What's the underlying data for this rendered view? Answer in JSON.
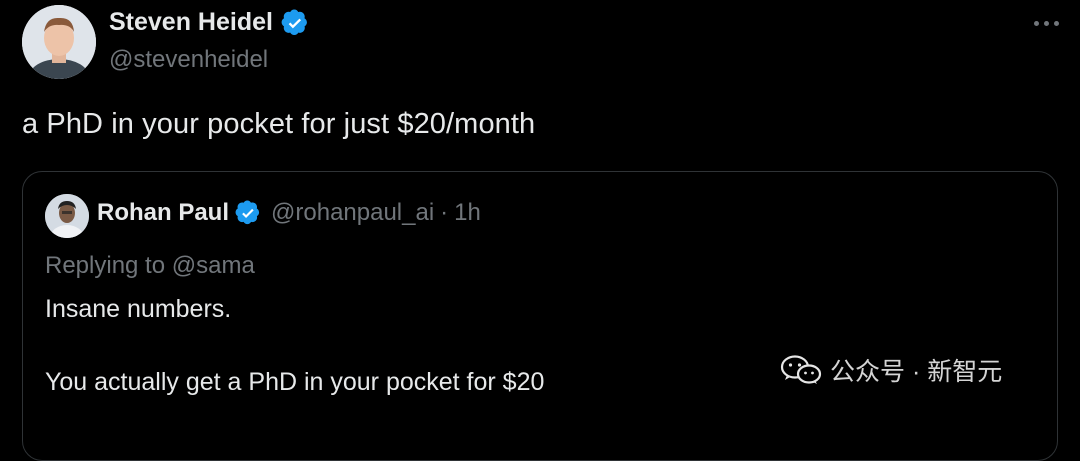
{
  "tweet": {
    "author_name": "Steven Heidel",
    "author_handle": "@stevenheidel",
    "text": "a PhD in your pocket for just $20/month",
    "more_icon": "more-horizontal-icon",
    "verified_color": "#1d9bf0"
  },
  "quoted": {
    "author_name": "Rohan Paul",
    "author_handle": "@rohanpaul_ai",
    "separator": "·",
    "time": "1h",
    "replying": "Replying to @sama",
    "line1": "Insane numbers.",
    "line2": "You actually get a PhD in your pocket for $20"
  },
  "watermark": {
    "text": "公众号 · 新智元",
    "icon": "wechat-icon"
  }
}
